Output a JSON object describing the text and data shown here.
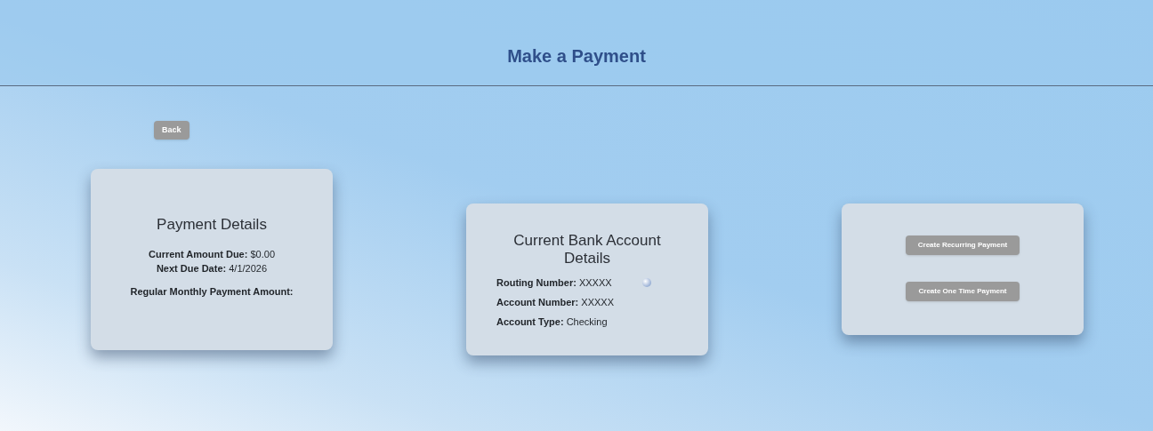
{
  "header": {
    "title": "Make a Payment"
  },
  "back_button": "Back",
  "payment_details": {
    "title": "Payment Details",
    "lines": [
      {
        "label": "Current Amount Due:",
        "value": "$0.00"
      },
      {
        "label": "Next Due Date:",
        "value": "4/1/2026"
      }
    ],
    "regular_amount_label": "Regular Monthly Payment Amount:"
  },
  "bank_account": {
    "title": "Current Bank Account Details",
    "lines": [
      {
        "label": "Routing Number:",
        "value": "XXXXX",
        "info": true
      },
      {
        "label": "Account Number:",
        "value": "XXXXX",
        "info": false
      },
      {
        "label": "Account Type:",
        "value": "Checking",
        "info": false
      }
    ]
  },
  "actions": [
    "Create Recurring Payment",
    "Create One Time Payment"
  ]
}
